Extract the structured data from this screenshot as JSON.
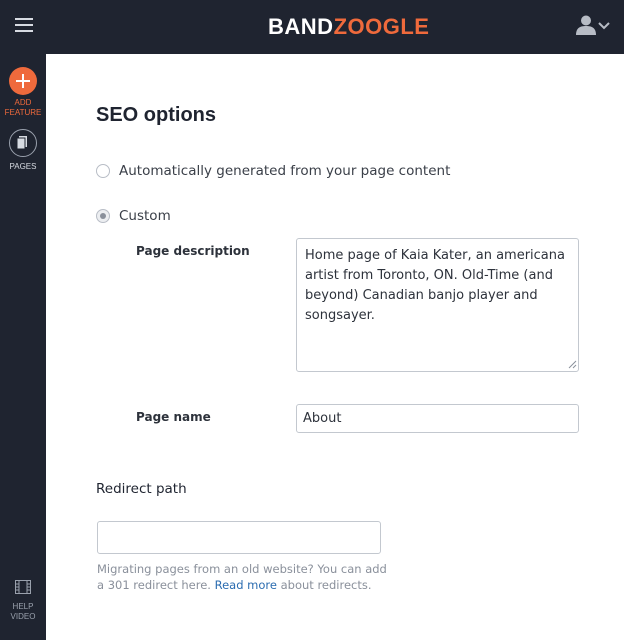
{
  "topbar": {
    "logo_part1": "BAND",
    "logo_part2": "ZOOGLE",
    "icons": {
      "menu": "hamburger-icon",
      "user": "user-icon",
      "dropdown": "chevron-down-icon"
    }
  },
  "sidebar": {
    "add_feature_line1": "ADD",
    "add_feature_line2": "FEATURE",
    "pages_label": "PAGES",
    "help_video_line1": "HELP",
    "help_video_line2": "VIDEO"
  },
  "colors": {
    "bar": "#1f2430",
    "accent": "#ef6a3c",
    "link": "#2b6cb0"
  },
  "seo": {
    "title": "SEO options",
    "option_auto": "Automatically generated from your page content",
    "option_custom": "Custom",
    "selected": "Custom",
    "page_description_label": "Page description",
    "page_description_value": "Home page of Kaia Kater, an americana artist from Toronto, ON. Old-Time (and beyond) Canadian banjo player and songsayer.",
    "page_name_label": "Page name",
    "page_name_value": "About",
    "redirect_label": "Redirect path",
    "redirect_value": "",
    "help_text_before": "Migrating pages from an old website? You can add a 301 redirect here. ",
    "help_link": "Read more",
    "help_text_after": " about redirects."
  }
}
